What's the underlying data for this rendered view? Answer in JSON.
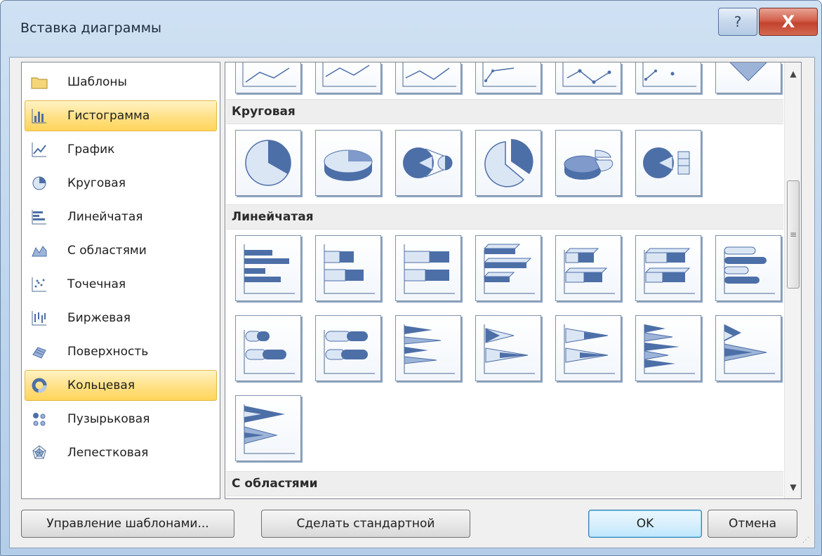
{
  "window": {
    "title": "Вставка диаграммы",
    "help_label": "?",
    "close_label": "X"
  },
  "sidebar": {
    "items": [
      {
        "label": "Шаблоны",
        "icon": "folder-icon"
      },
      {
        "label": "Гистограмма",
        "icon": "column-chart-icon",
        "selected": true
      },
      {
        "label": "График",
        "icon": "line-chart-icon"
      },
      {
        "label": "Круговая",
        "icon": "pie-chart-icon"
      },
      {
        "label": "Линейчатая",
        "icon": "bar-chart-icon"
      },
      {
        "label": "С областями",
        "icon": "area-chart-icon"
      },
      {
        "label": "Точечная",
        "icon": "scatter-chart-icon"
      },
      {
        "label": "Биржевая",
        "icon": "stock-chart-icon"
      },
      {
        "label": "Поверхность",
        "icon": "surface-chart-icon"
      },
      {
        "label": "Кольцевая",
        "icon": "doughnut-chart-icon",
        "highlighted": true
      },
      {
        "label": "Пузырьковая",
        "icon": "bubble-chart-icon"
      },
      {
        "label": "Лепестковая",
        "icon": "radar-chart-icon"
      }
    ]
  },
  "gallery": {
    "sections": [
      {
        "title": "Круговая"
      },
      {
        "title": "Линейчатая"
      },
      {
        "title": "С областями"
      }
    ]
  },
  "buttons": {
    "manage_templates": "Управление шаблонами...",
    "set_default": "Сделать стандартной",
    "ok": "OK",
    "cancel": "Отмена"
  },
  "colors": {
    "selection": "#ffe28a",
    "chart_fill": "#4d6fa8",
    "chart_light": "#dbe6f5"
  }
}
